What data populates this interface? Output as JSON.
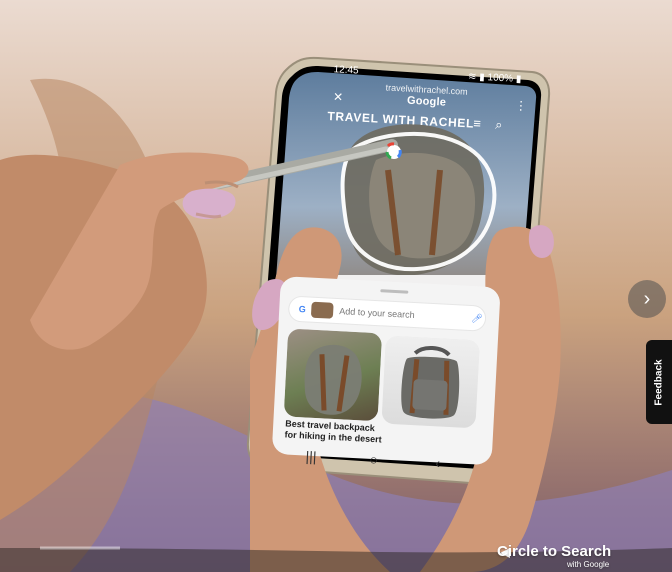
{
  "phone": {
    "status": {
      "time": "12:45",
      "battery": "100%"
    },
    "browser": {
      "url": "travelwithrachel.com",
      "engine_logo": "Google"
    },
    "site": {
      "title": "TRAVEL WITH RACHEL"
    },
    "sheet": {
      "search_placeholder": "Add to your search",
      "results": [
        {
          "caption": "Best travel backpack for hiking in the desert"
        }
      ]
    }
  },
  "overlay": {
    "brand_line_1": "Circle to Search",
    "brand_line_2": "with Google",
    "feedback": "Feedback"
  },
  "colors": {
    "google_blue": "#4285f4",
    "sheet_bg": "#f4f4f4"
  }
}
